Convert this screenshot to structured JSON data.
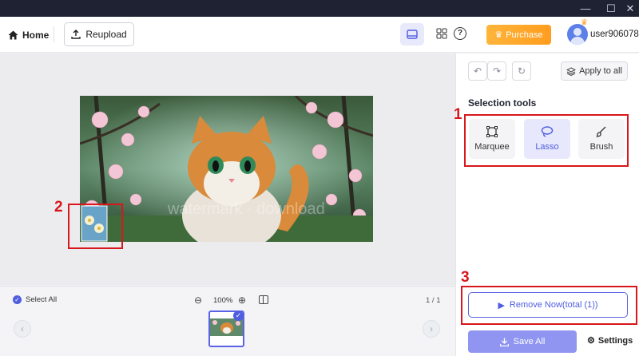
{
  "header": {
    "home_label": "Home",
    "reupload_label": "Reupload",
    "purchase_label": "Purchase",
    "username": "user906078"
  },
  "toolbar": {
    "apply_all_label": "Apply to all"
  },
  "selection": {
    "title": "Selection tools",
    "tools": [
      {
        "label": "Marquee",
        "icon": "marquee-icon"
      },
      {
        "label": "Lasso",
        "icon": "lasso-icon",
        "selected": true
      },
      {
        "label": "Brush",
        "icon": "brush-icon"
      }
    ]
  },
  "actions": {
    "remove_label": "Remove Now(total (1))",
    "save_label": "Save All",
    "settings_label": "Settings"
  },
  "strip": {
    "select_all_label": "Select All",
    "zoom_level": "100%",
    "page_count": "1 / 1"
  },
  "annotations": {
    "marker_1": "1",
    "marker_2": "2",
    "marker_3": "3"
  },
  "watermark_text": "watermark · download",
  "colors": {
    "accent": "#4f5de0",
    "annotation_red": "#d8161c",
    "purchase_orange": "#ff9d1f",
    "titlebar": "#1f2232"
  }
}
